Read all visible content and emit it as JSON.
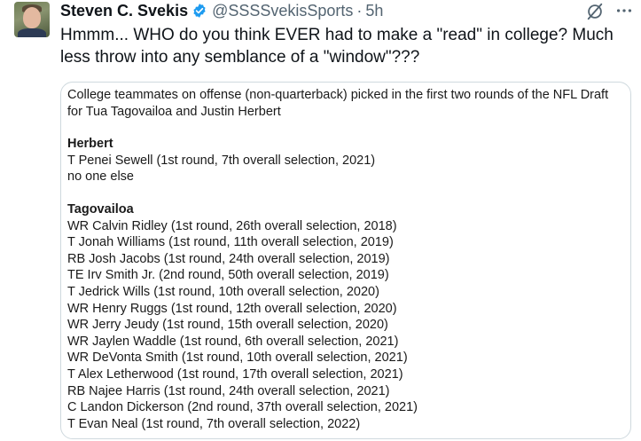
{
  "tweet": {
    "author": {
      "display_name": "Steven C. Svekis",
      "handle": "@SSSSvekisSports",
      "verified": true
    },
    "separator": "·",
    "time": "5h",
    "text": "Hmmm... WHO do you think EVER had to make a \"read\" in college? Much less throw into any semblance of a \"window\"???",
    "icons": {
      "verified": "verified-badge-icon",
      "grok": "grok-icon",
      "more": "more-options-icon"
    },
    "colors": {
      "verified": "#1d9bf0",
      "secondary_text": "#536471",
      "card_border": "#cfd9de"
    }
  },
  "card": {
    "intro": "College teammates on offense (non-quarterback) picked in the first two rounds of the NFL Draft for Tua Tagovailoa and Justin Herbert",
    "herbert": {
      "title": "Herbert",
      "rows": [
        "T Penei Sewell (1st round, 7th overall selection, 2021)",
        "no one else"
      ]
    },
    "tagovailoa": {
      "title": "Tagovailoa",
      "rows": [
        "WR Calvin Ridley (1st round, 26th overall selection, 2018)",
        "T Jonah Williams (1st round, 11th overall selection, 2019)",
        "RB Josh Jacobs (1st round, 24th overall selection, 2019)",
        "TE Irv Smith Jr. (2nd round, 50th overall selection, 2019)",
        "T Jedrick Wills (1st round, 10th overall selection, 2020)",
        "WR Henry Ruggs (1st round, 12th overall selection, 2020)",
        "WR Jerry Jeudy (1st round, 15th overall selection, 2020)",
        "WR Jaylen Waddle (1st round, 6th overall selection, 2021)",
        "WR DeVonta Smith (1st round, 10th overall selection, 2021)",
        "T Alex Letherwood (1st round, 17th overall selection, 2021)",
        "RB Najee Harris (1st round, 24th overall selection, 2021)",
        "C Landon Dickerson (2nd round, 37th overall selection, 2021)",
        "T Evan Neal (1st round, 7th overall selection, 2022)"
      ]
    }
  }
}
